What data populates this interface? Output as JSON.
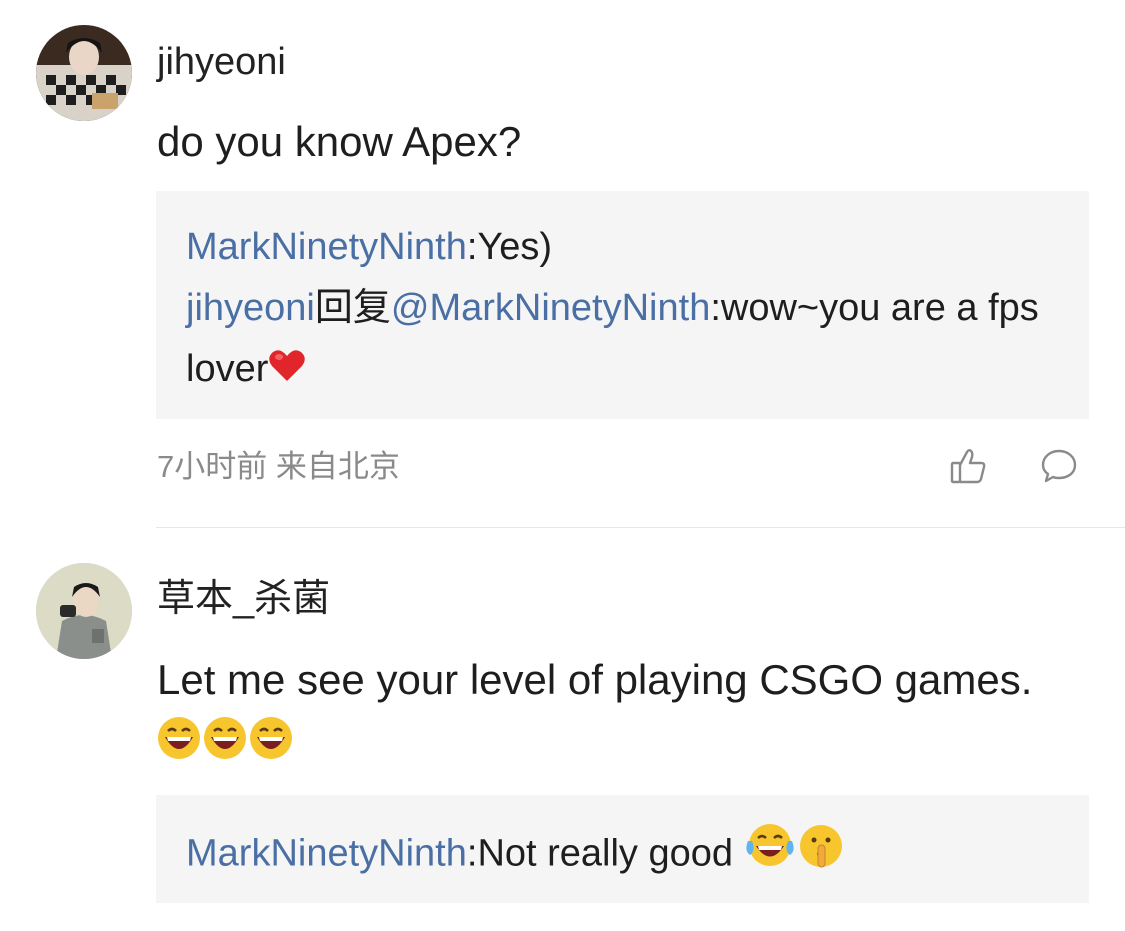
{
  "comments": [
    {
      "username": "jihyeoni",
      "text": "do you know Apex?",
      "replies": [
        {
          "author": "MarkNinetyNinth",
          "sep": ":",
          "text": "Yes)"
        },
        {
          "author": "jihyeoni",
          "reply_word": "回复",
          "mention": "@MarkNinetyNinth",
          "sep": ":",
          "text": "wow~you are a fps lover"
        }
      ],
      "meta": "7小时前 来自北京"
    },
    {
      "username": "草本_杀菌",
      "text": "Let me see your level of playing CSGO games.",
      "replies": [
        {
          "author": "MarkNinetyNinth",
          "sep": ":",
          "text": "Not really good "
        }
      ]
    }
  ],
  "icons": {
    "like": "thumbs-up-icon",
    "comment": "comment-bubble-icon",
    "heart": "red-heart-emoji",
    "grin": "grinning-emoji",
    "tears": "tears-of-joy-emoji",
    "shush": "shushing-face-emoji"
  },
  "colors": {
    "link": "#4a6fa5",
    "reply_bg": "#f5f5f5",
    "meta": "#8a8a8a"
  }
}
